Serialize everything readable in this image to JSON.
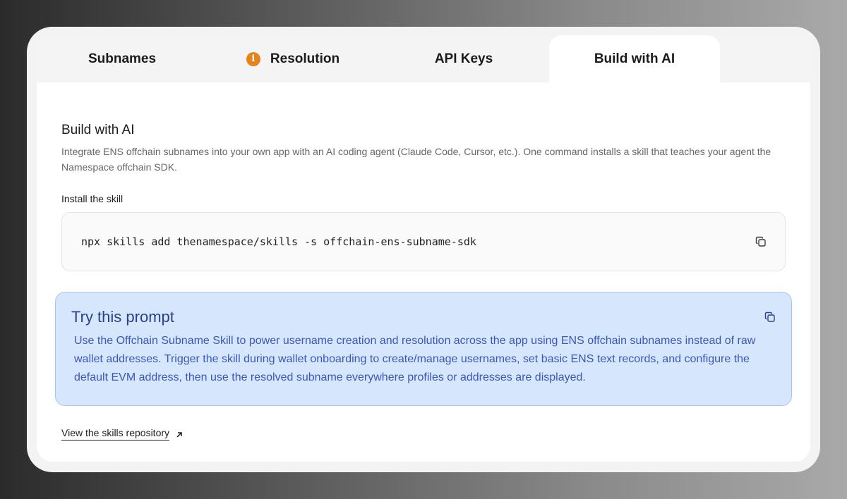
{
  "tabs": [
    {
      "label": "Subnames",
      "active": false
    },
    {
      "label": "Resolution",
      "active": false,
      "icon": "info-icon"
    },
    {
      "label": "API Keys",
      "active": false
    },
    {
      "label": "Build with AI",
      "active": true
    }
  ],
  "main": {
    "title": "Build with AI",
    "description": "Integrate ENS offchain subnames into your own app with an AI coding agent (Claude Code, Cursor, etc.). One command installs a skill that teaches your agent the Namespace offchain SDK.",
    "install_label": "Install the skill",
    "install_command": "npx skills add thenamespace/skills -s offchain-ens-subname-sdk",
    "prompt": {
      "title": "Try this prompt",
      "text": "Use the Offchain Subname Skill to power username creation and resolution across the app using ENS offchain subnames instead of raw wallet addresses. Trigger the skill during wallet onboarding to create/manage usernames, set basic ENS text records, and configure the default EVM address, then use the resolved subname everywhere profiles or addresses are displayed."
    },
    "repo_link": "View the skills repository"
  },
  "icons": {
    "info": "info-icon",
    "copy": "copy-icon",
    "external": "arrow-up-right-icon"
  },
  "colors": {
    "info_badge": "#e2831b",
    "prompt_bg": "#d6e6fc",
    "prompt_border": "#a9c4f0",
    "prompt_title": "#2b3f8f",
    "prompt_text": "#3a58b8"
  }
}
